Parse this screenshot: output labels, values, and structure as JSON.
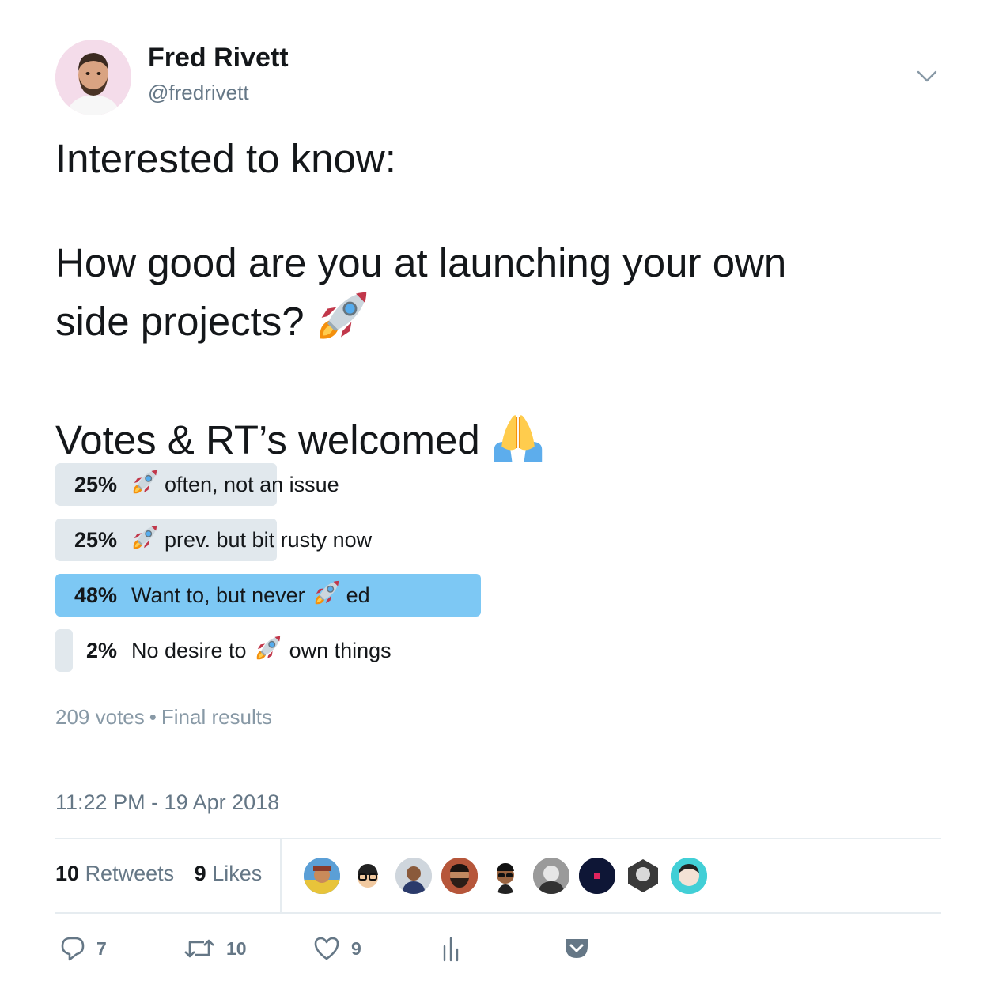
{
  "user": {
    "name": "Fred Rivett",
    "handle": "@fredrivett"
  },
  "tweet": {
    "line1": "Interested to know:",
    "line2": "How good are you at launching your own",
    "line3": "side projects?",
    "line4": "Votes & RT’s welcomed"
  },
  "poll": {
    "choices": [
      {
        "percent": "25%",
        "before": "",
        "after": "often, not an issue",
        "fraction": 0.25
      },
      {
        "percent": "25%",
        "before": "",
        "after": "prev. but bit rusty now",
        "fraction": 0.25
      },
      {
        "percent": "48%",
        "before": "Want to, but never",
        "after": "ed",
        "fraction": 0.48
      },
      {
        "percent": "2%",
        "before": "No desire to",
        "after": "own things",
        "fraction": 0.02
      }
    ],
    "votes": "209 votes",
    "separator": "•",
    "status": "Final results",
    "winner_color": "#7dc8f4",
    "bar_color": "#e1e8ed"
  },
  "timestamp": "11:22 PM - 19 Apr 2018",
  "stats": {
    "retweets_count": "10",
    "retweets_label": "Retweets",
    "likes_count": "9",
    "likes_label": "Likes"
  },
  "actions": {
    "reply_count": "7",
    "retweet_count": "10",
    "like_count": "9"
  },
  "icons": [
    "chevron-down-icon",
    "rocket-emoji",
    "folded-hands-emoji",
    "reply-icon",
    "retweet-icon",
    "heart-icon",
    "analytics-icon",
    "pocket-icon"
  ]
}
